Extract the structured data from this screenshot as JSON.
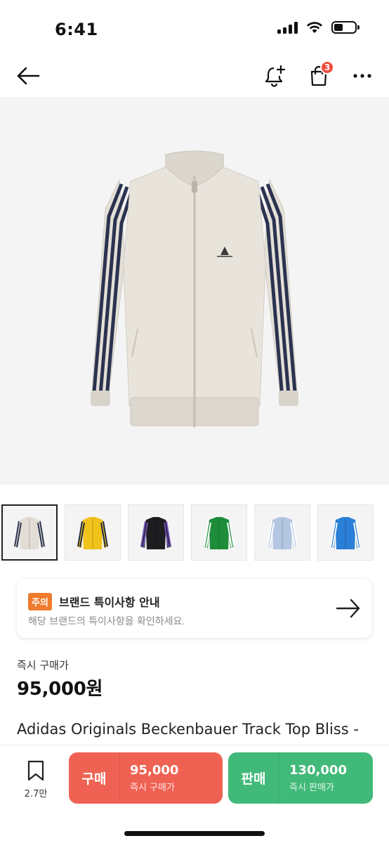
{
  "status_bar": {
    "time": "6:41"
  },
  "nav": {
    "cart_badge": "3"
  },
  "product": {
    "thumbnails": [
      {
        "color": "#e2ddd4",
        "stripe": "#2d3550",
        "icon": "jacket-thumb-ivory"
      },
      {
        "color": "#f0c21a",
        "stripe": "#1f2a44",
        "icon": "jacket-thumb-yellow"
      },
      {
        "color": "#1d1d1f",
        "stripe": "#6a4fb5",
        "icon": "jacket-thumb-black"
      },
      {
        "color": "#1e8d3a",
        "stripe": "#ffffff",
        "icon": "jacket-thumb-green"
      },
      {
        "color": "#b3c7e3",
        "stripe": "#ffffff",
        "icon": "jacket-thumb-light-blue"
      },
      {
        "color": "#2a7fd6",
        "stripe": "#ffffff",
        "icon": "jacket-thumb-blue"
      }
    ]
  },
  "notice": {
    "tag": "주의",
    "title": "브랜드 특이사항 안내",
    "subtitle": "해당 브랜드의 특이사항을 확인하세요."
  },
  "price": {
    "label": "즉시 구매가",
    "value": "95,000원"
  },
  "title": "Adidas Originals Beckenbauer Track Top Bliss -",
  "bottom": {
    "bookmark_count": "2.7만",
    "buy": {
      "label": "구매",
      "price": "95,000",
      "sub": "즉시 구매가",
      "color": "#ef6253"
    },
    "sell": {
      "label": "판매",
      "price": "130,000",
      "sub": "즉시 판매가",
      "color": "#41b979"
    }
  }
}
